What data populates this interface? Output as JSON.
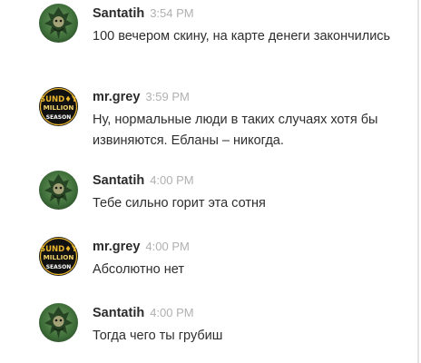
{
  "messages": [
    {
      "author": "Santatih",
      "time": "3:54 PM",
      "avatar_icon": "santatih-avatar-icon",
      "text": "100 вечером скину, на карте денеги закончились"
    },
    {
      "author": "mr.grey",
      "time": "3:59 PM",
      "avatar_icon": "sunday-million-avatar-icon",
      "avatar_logo": [
        "SUND",
        "MILLION",
        "SEASON"
      ],
      "text": "Ну, нормальные люди в таких случаях хотя бы извиняются. Ебланы – никогда."
    },
    {
      "author": "Santatih",
      "time": "4:00 PM",
      "avatar_icon": "santatih-avatar-icon",
      "text": "Тебе сильно горит эта сотня"
    },
    {
      "author": "mr.grey",
      "time": "4:00 PM",
      "avatar_icon": "sunday-million-avatar-icon",
      "avatar_logo": [
        "SUND",
        "MILLION",
        "SEASON"
      ],
      "text": "Абсолютно нет"
    },
    {
      "author": "Santatih",
      "time": "4:00 PM",
      "avatar_icon": "santatih-avatar-icon",
      "text": "Тогда чего ты грубиш"
    }
  ],
  "colors": {
    "author": "#2b2b2b",
    "timestamp": "#b0b0b0",
    "text": "#2e2e2e",
    "santatih_avatar_bg": "#3f6f3a",
    "sunday_avatar_bg": "#111111",
    "sunday_logo_gold": "#e8b52c"
  }
}
